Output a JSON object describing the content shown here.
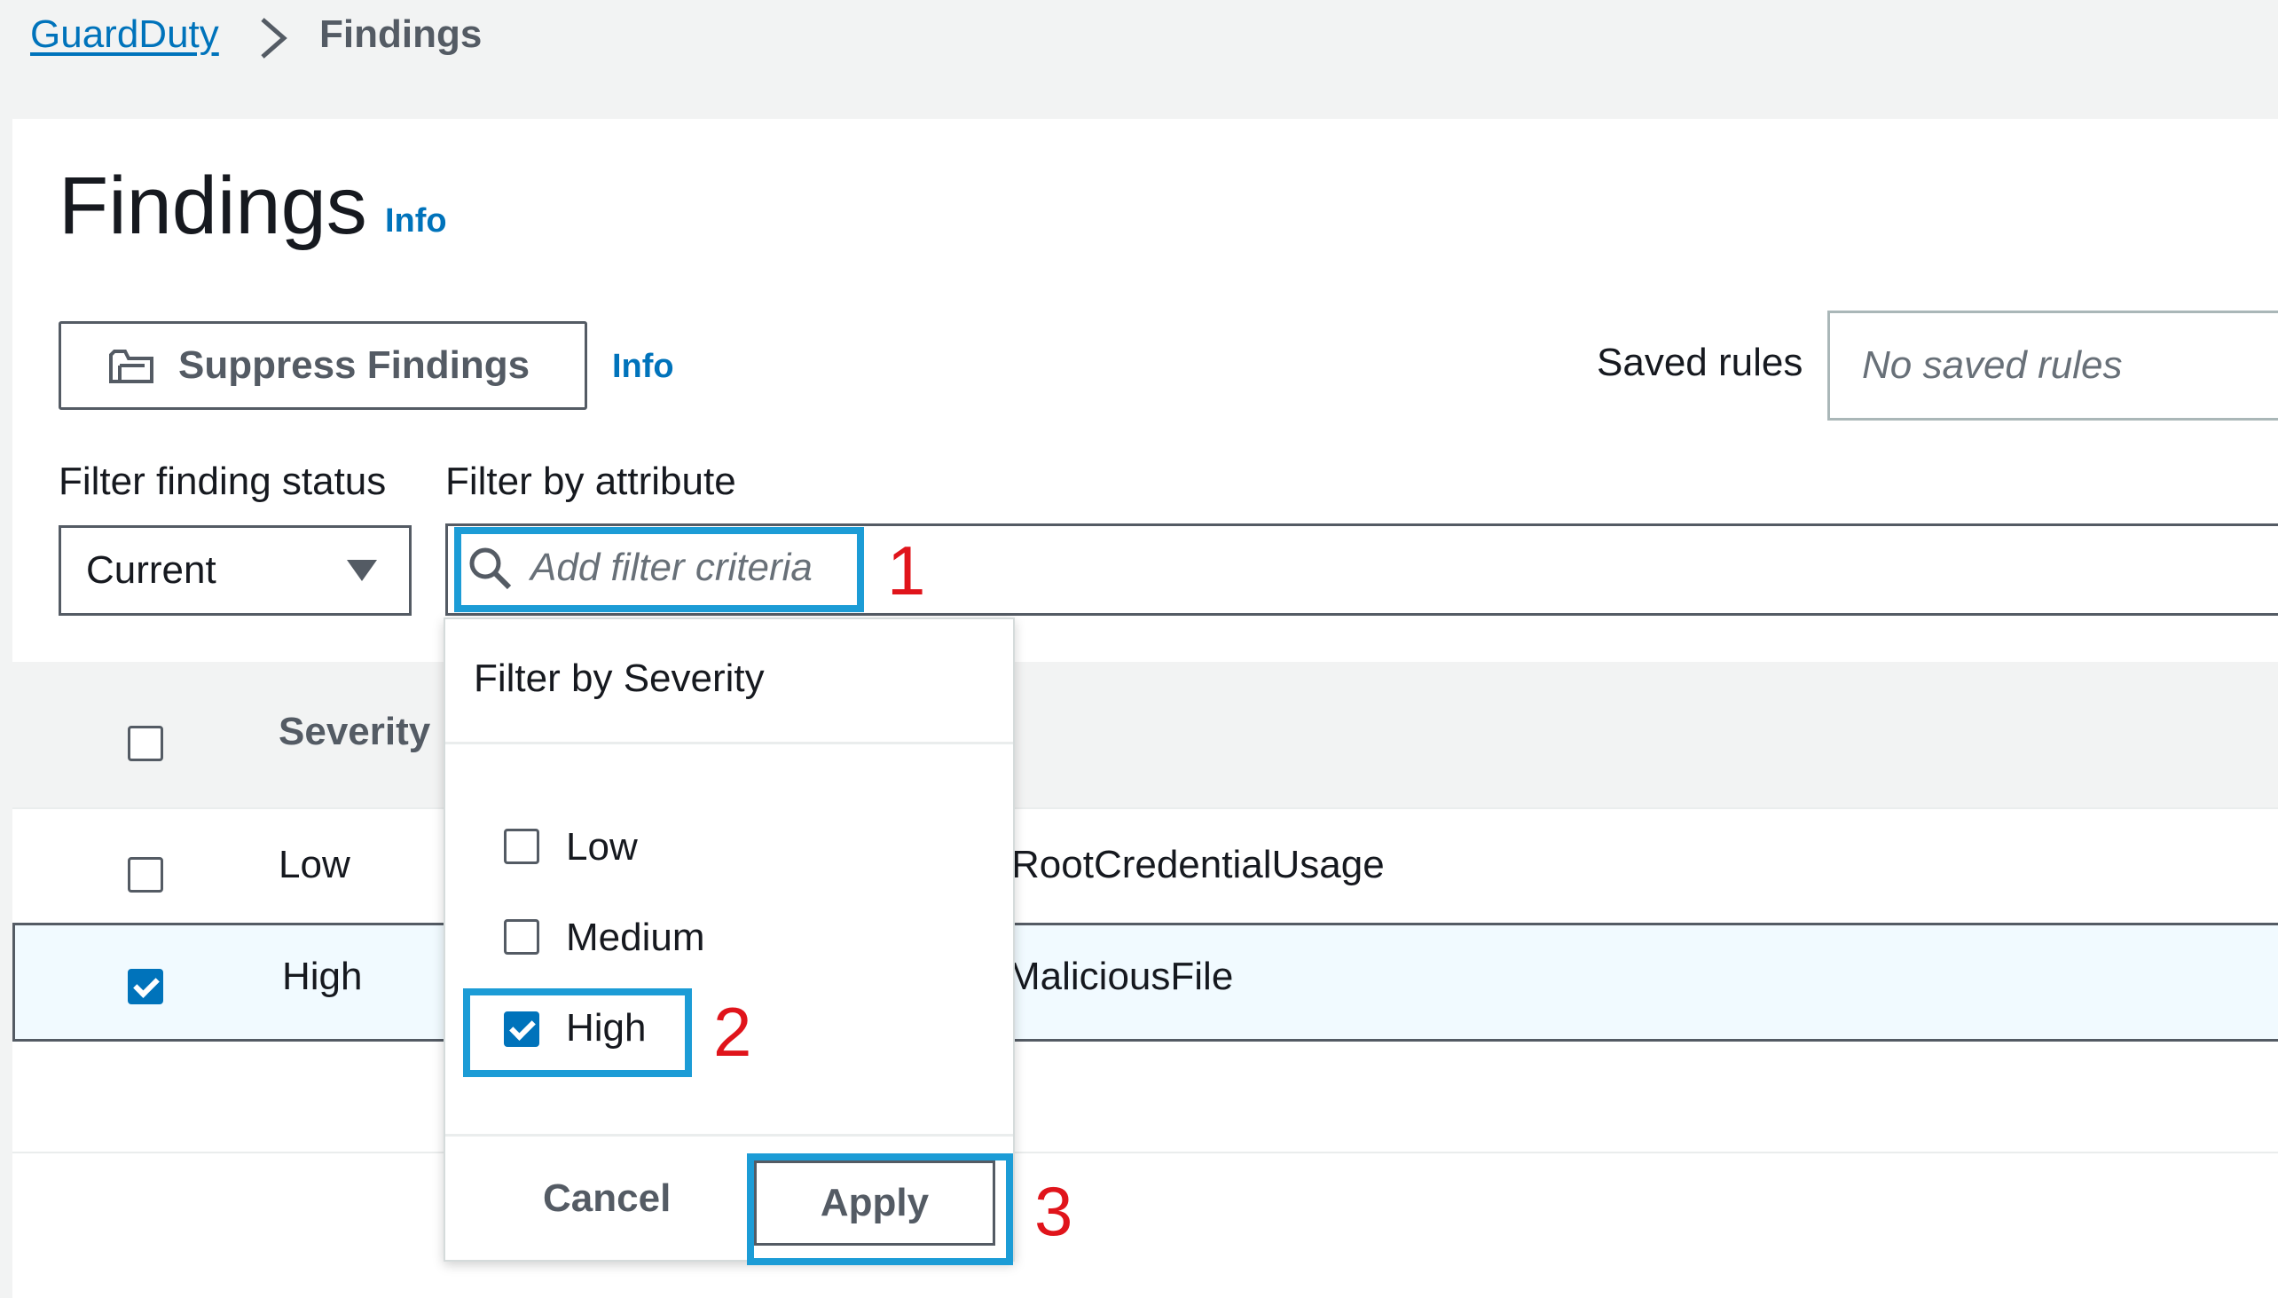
{
  "breadcrumb": {
    "root": "GuardDuty",
    "current": "Findings"
  },
  "page": {
    "title": "Findings",
    "info": "Info"
  },
  "toolbar": {
    "suppress_label": "Suppress Findings",
    "info": "Info",
    "saved_rules_label": "Saved rules",
    "saved_rules_value": "No saved rules"
  },
  "filters": {
    "status_label": "Filter finding status",
    "status_value": "Current",
    "attribute_label": "Filter by attribute",
    "attribute_placeholder": "Add filter criteria"
  },
  "table": {
    "columns": [
      "Severity"
    ],
    "rows": [
      {
        "severity": "Low",
        "finding": "RootCredentialUsage",
        "checked": false
      },
      {
        "severity": "High",
        "finding": "MaliciousFile",
        "checked": true
      }
    ]
  },
  "severity_menu": {
    "title": "Filter by Severity",
    "options": [
      {
        "label": "Low",
        "checked": false
      },
      {
        "label": "Medium",
        "checked": false
      },
      {
        "label": "High",
        "checked": true
      }
    ],
    "cancel": "Cancel",
    "apply": "Apply"
  },
  "annotations": {
    "step1": "1",
    "step2": "2",
    "step3": "3",
    "highlight_color": "#1c9cd6",
    "number_color": "#e0141b"
  },
  "icons": [
    "chevron-right-icon",
    "folder-icon",
    "caret-down-icon",
    "search-icon",
    "checkmark-icon"
  ]
}
